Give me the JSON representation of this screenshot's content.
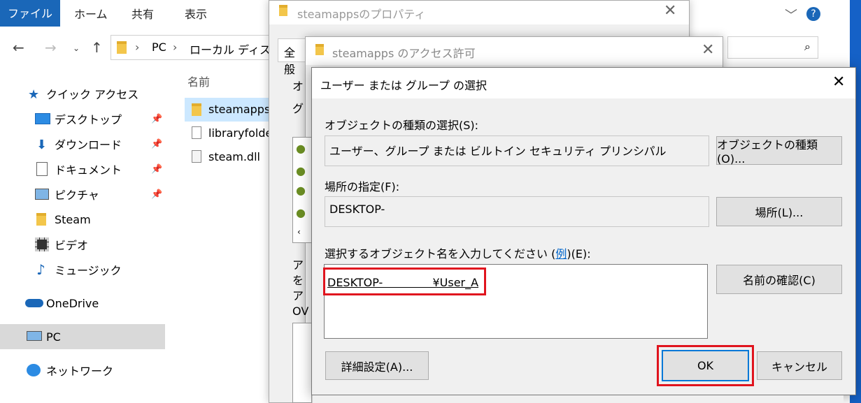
{
  "explorer": {
    "ribbon_tabs": [
      "ファイル",
      "ホーム",
      "共有",
      "表示"
    ],
    "address": {
      "pc": "PC",
      "drive": "ローカル ディスク"
    },
    "sidebar": {
      "quick_access": "クイック アクセス",
      "items": [
        "デスクトップ",
        "ダウンロード",
        "ドキュメント",
        "ピクチャ",
        "Steam",
        "ビデオ",
        "ミュージック"
      ],
      "onedrive": "OneDrive",
      "pc": "PC",
      "network": "ネットワーク"
    },
    "column_name": "名前",
    "files": [
      "steamapps",
      "libraryfolde",
      "steam.dll"
    ]
  },
  "properties_window": {
    "title": "steamappsのプロパティ",
    "tab_general": "全般"
  },
  "access_window": {
    "title": "steamapps のアクセス許可",
    "partial": [
      "オ",
      "グ",
      "ア",
      "を",
      "ア",
      "OV"
    ]
  },
  "dialog": {
    "title": "ユーザー または グループ の選択",
    "object_type_label": "オブジェクトの種類の選択(S):",
    "object_type_value": "ユーザー、グループ または ビルトイン セキュリティ プリンシパル",
    "object_type_button": "オブジェクトの種類(O)...",
    "location_label": "場所の指定(F):",
    "location_value": "DESKTOP-",
    "location_button": "場所(L)...",
    "enter_label_pre": "選択するオブジェクト名を入力してください (",
    "enter_label_link": "例",
    "enter_label_post": ")(E):",
    "entered_name": "DESKTOP-              ¥User_A",
    "check_names_button": "名前の確認(C)",
    "advanced_button": "詳細設定(A)...",
    "ok_button": "OK",
    "cancel_button": "キャンセル"
  },
  "colors": {
    "file_tab": "#1a67b8",
    "highlight": "#e0141e",
    "selected_row": "#cce8ff"
  }
}
